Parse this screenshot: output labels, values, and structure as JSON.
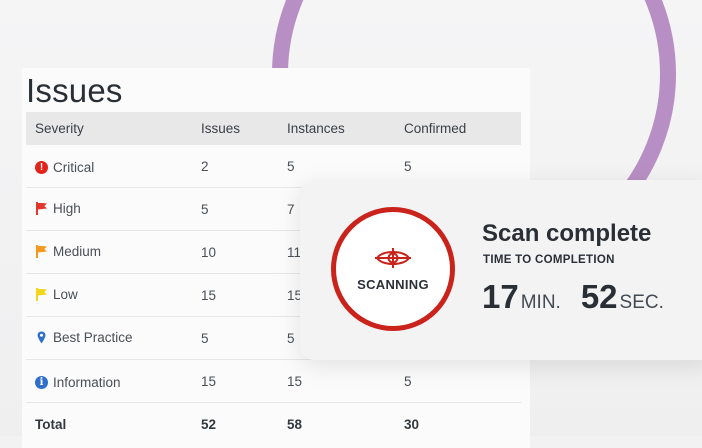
{
  "issues": {
    "title": "Issues",
    "columns": [
      "Severity",
      "Issues",
      "Instances",
      "Confirmed"
    ],
    "rows": [
      {
        "severity": "Critical",
        "icon": "critical-icon",
        "issues": "2",
        "instances": "5",
        "confirmed": "5"
      },
      {
        "severity": "High",
        "icon": "flag-red-icon",
        "issues": "5",
        "instances": "7",
        "confirmed": ""
      },
      {
        "severity": "Medium",
        "icon": "flag-orange-icon",
        "issues": "10",
        "instances": "11",
        "confirmed": ""
      },
      {
        "severity": "Low",
        "icon": "flag-yellow-icon",
        "issues": "15",
        "instances": "15",
        "confirmed": ""
      },
      {
        "severity": "Best Practice",
        "icon": "pin-icon",
        "issues": "5",
        "instances": "5",
        "confirmed": ""
      },
      {
        "severity": "Information",
        "icon": "info-icon",
        "issues": "15",
        "instances": "15",
        "confirmed": "5"
      }
    ],
    "total": {
      "label": "Total",
      "issues": "52",
      "instances": "58",
      "confirmed": "30"
    }
  },
  "scan": {
    "status_label": "SCANNING",
    "title": "Scan complete",
    "subtitle": "TIME TO COMPLETION",
    "minutes": "17",
    "minutes_unit": "MIN.",
    "seconds": "52",
    "seconds_unit": "SEC."
  },
  "colors": {
    "ring": "#b88fc4",
    "critical": "#e2231a",
    "high": "#e4362b",
    "medium": "#f39a1e",
    "low": "#f3d51c",
    "best_practice": "#2f6fc9",
    "info": "#2f6fc9",
    "scan_accent": "#c9231b"
  }
}
